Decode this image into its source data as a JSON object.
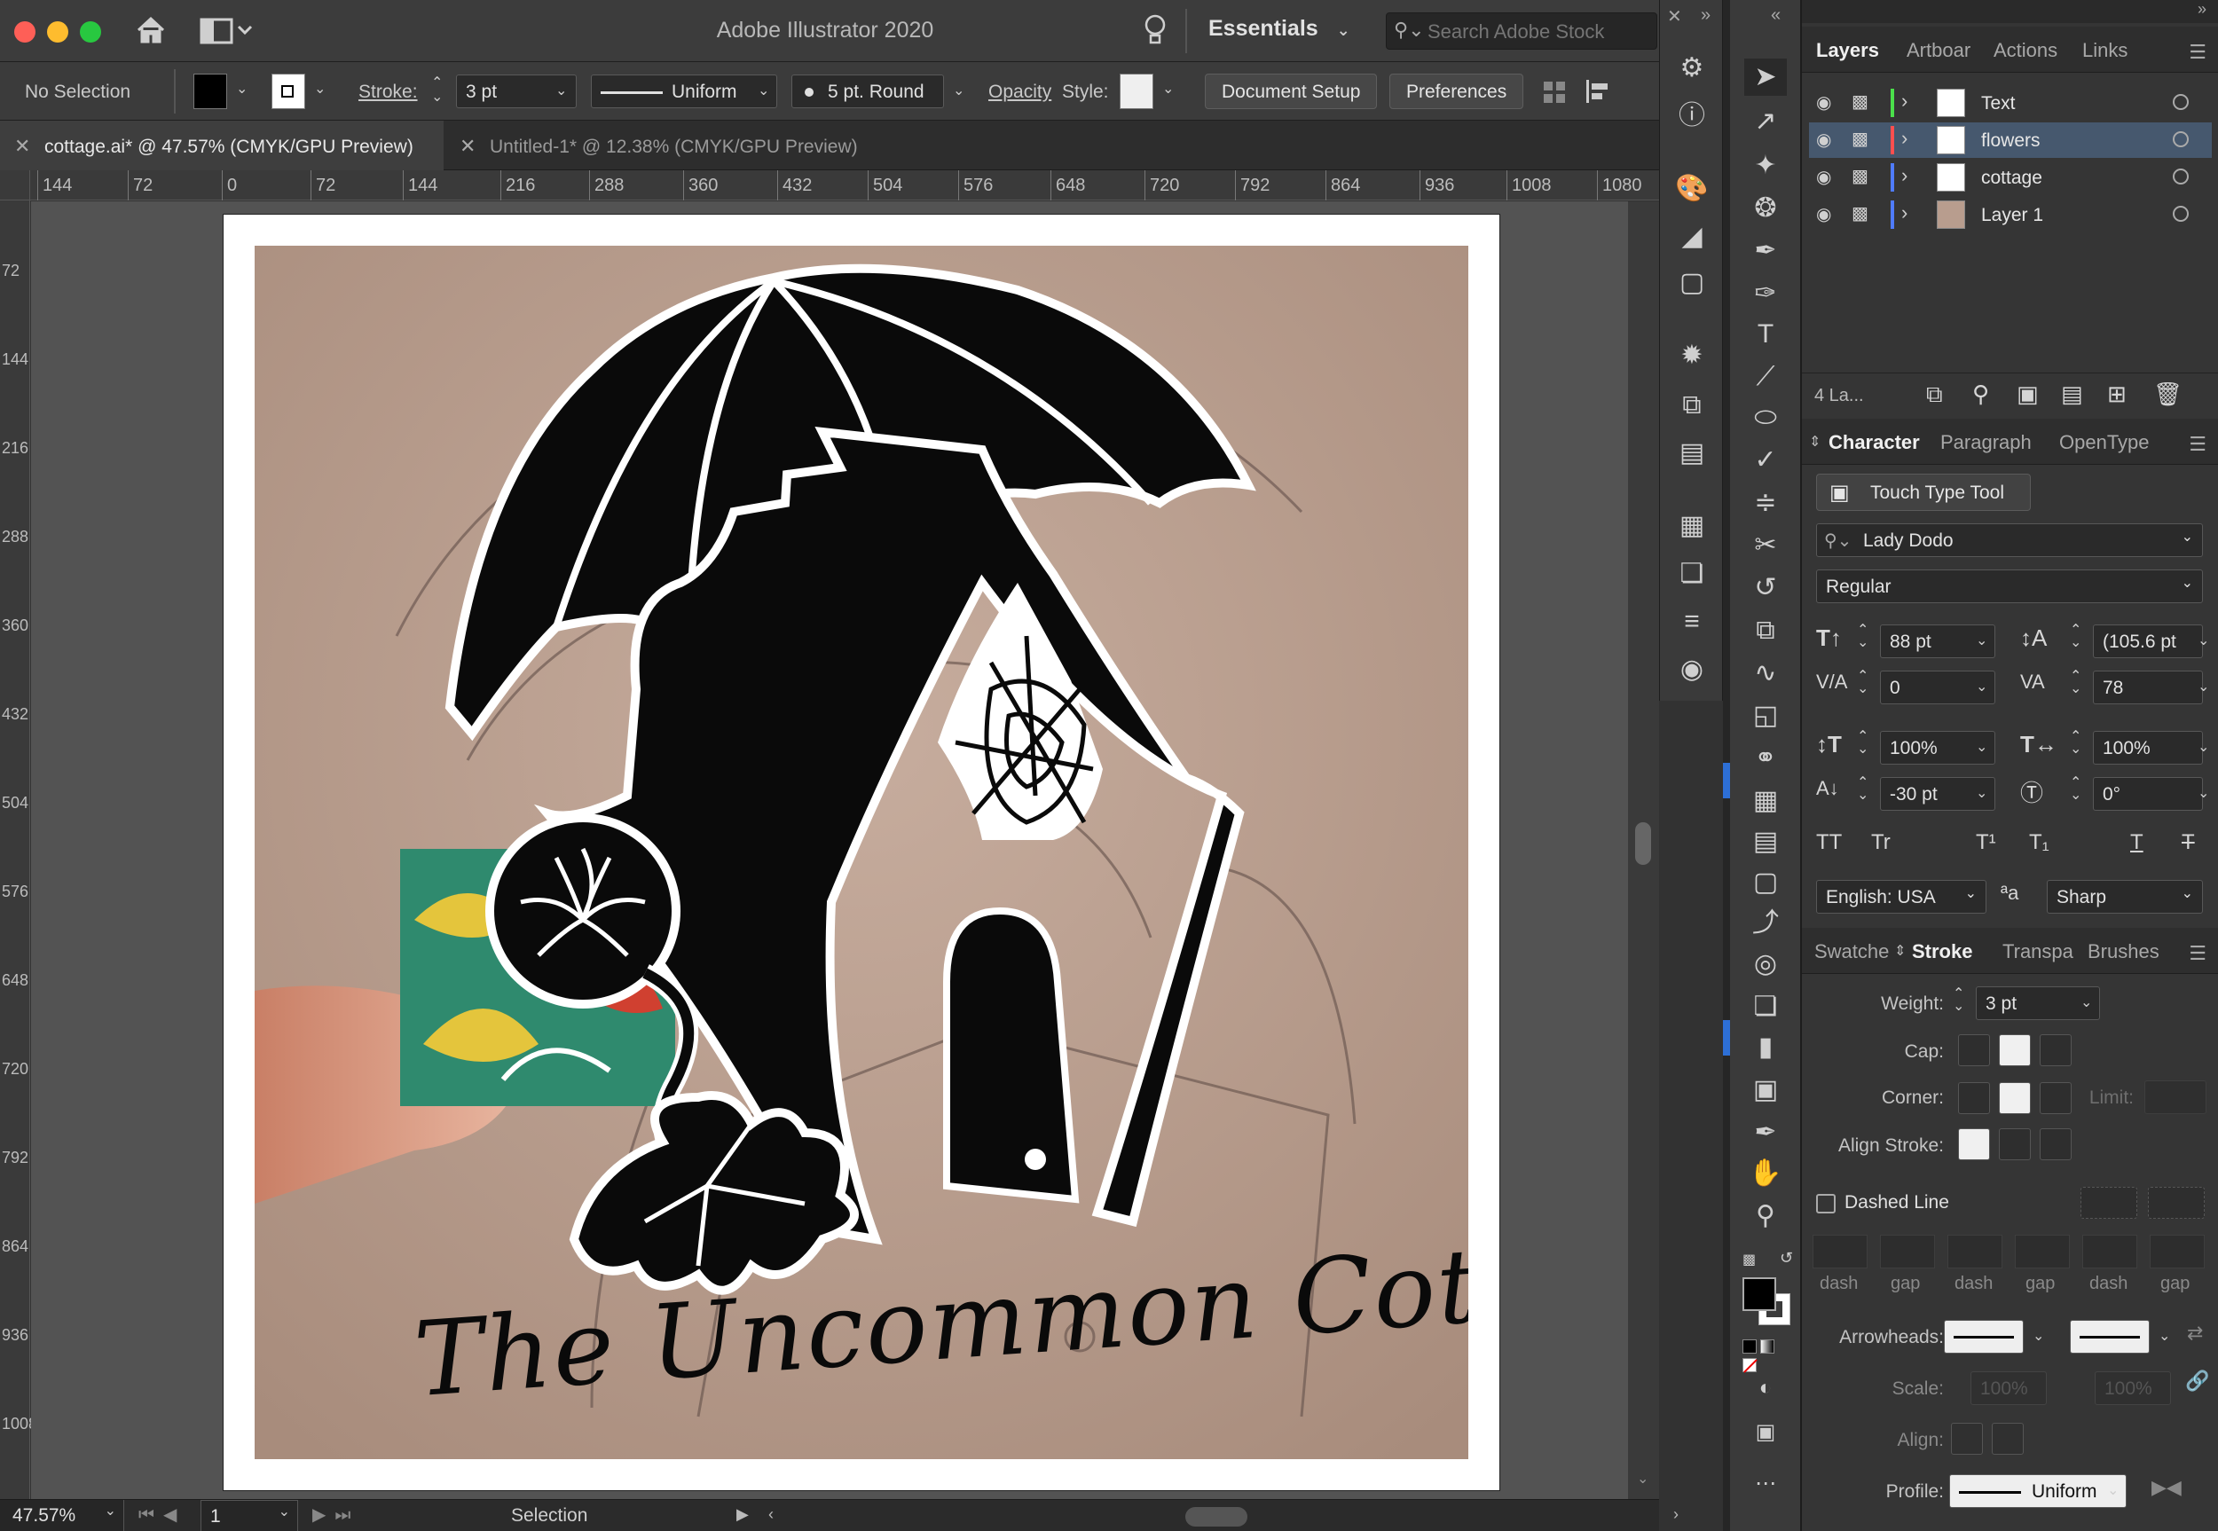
{
  "app": {
    "title": "Adobe Illustrator 2020",
    "workspace": "Essentials",
    "stock_search_placeholder": "Search Adobe Stock"
  },
  "controlbar": {
    "selection": "No Selection",
    "fill_color": "#000000",
    "stroke_label": "Stroke:",
    "stroke_weight": "3 pt",
    "stroke_profile": "Uniform",
    "brush": "5 pt. Round",
    "opacity_label": "Opacity",
    "style_label": "Style:",
    "document_setup": "Document Setup",
    "preferences": "Preferences"
  },
  "tabs": [
    {
      "label": "cottage.ai* @ 47.57% (CMYK/GPU Preview)",
      "active": true
    },
    {
      "label": "Untitled-1* @ 12.38% (CMYK/GPU Preview)",
      "active": false
    }
  ],
  "ruler": {
    "top": [
      "144",
      "72",
      "0",
      "72",
      "144",
      "216",
      "288",
      "360",
      "432",
      "504",
      "576",
      "648",
      "720",
      "792",
      "864",
      "936",
      "1008",
      "1080"
    ],
    "left": [
      "72",
      "144",
      "216",
      "288",
      "360",
      "432",
      "504",
      "576",
      "648",
      "720",
      "792",
      "864",
      "936",
      "1008"
    ]
  },
  "artwork": {
    "headline": "The Uncommon Cottage"
  },
  "statusbar": {
    "zoom": "47.57%",
    "artboard": "1",
    "tool": "Selection"
  },
  "layers_panel": {
    "tabs": [
      "Layers",
      "Artboar",
      "Actions",
      "Links"
    ],
    "layers": [
      {
        "name": "Text",
        "color": "#4be04b",
        "selected": false
      },
      {
        "name": "flowers",
        "color": "#ff4f4f",
        "selected": true
      },
      {
        "name": "cottage",
        "color": "#4f7bff",
        "selected": false
      },
      {
        "name": "Layer 1",
        "color": "#4f7bff",
        "selected": false
      }
    ],
    "count_label": "4 La..."
  },
  "character_panel": {
    "tabs": [
      "Character",
      "Paragraph",
      "OpenType"
    ],
    "touch_type": "Touch Type Tool",
    "font_family": "Lady Dodo",
    "font_style": "Regular",
    "font_size": "88 pt",
    "leading": "(105.6 pt",
    "kerning": "0",
    "tracking": "78",
    "vertical_scale": "100%",
    "horizontal_scale": "100%",
    "baseline_shift": "-30 pt",
    "rotation": "0°",
    "language": "English: USA",
    "antialias": "Sharp"
  },
  "stroke_panel": {
    "tabs": [
      "Swatche",
      "Stroke",
      "Transpa",
      "Brushes"
    ],
    "weight_label": "Weight:",
    "weight": "3 pt",
    "cap_label": "Cap:",
    "corner_label": "Corner:",
    "limit_label": "Limit:",
    "align_label": "Align Stroke:",
    "dashed_line": "Dashed Line",
    "dash_labels": [
      "dash",
      "gap",
      "dash",
      "gap",
      "dash",
      "gap"
    ],
    "arrowheads_label": "Arrowheads:",
    "scale_label": "Scale:",
    "scale_1": "100%",
    "scale_2": "100%",
    "align2_label": "Align:",
    "profile_label": "Profile:",
    "profile": "Uniform"
  },
  "colors": {
    "accent_blue": "#46586e",
    "chrome": "#3a3a3a"
  }
}
